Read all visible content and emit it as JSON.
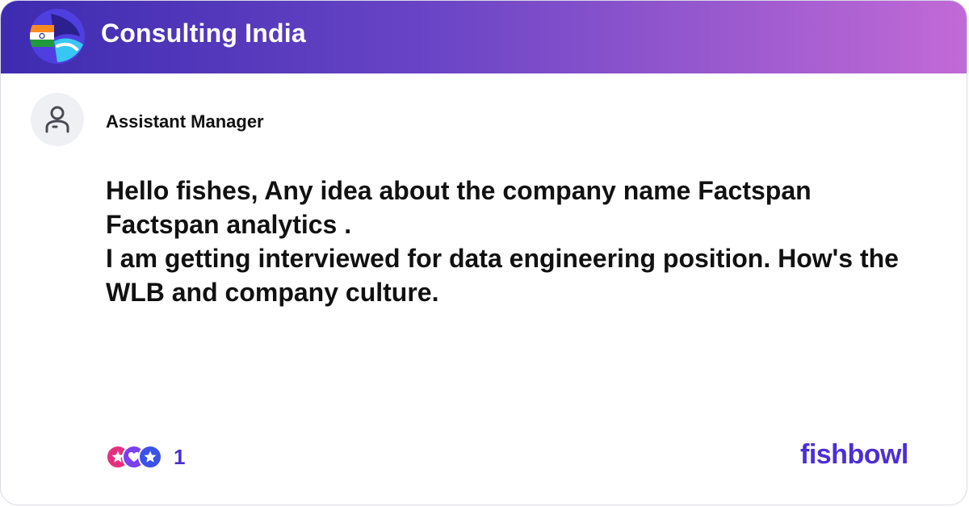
{
  "header": {
    "bowl_name": "Consulting India",
    "logo_icon": "india-flag-globe-icon"
  },
  "post": {
    "author_title": "Assistant Manager",
    "avatar_icon": "user-icon",
    "lines": [
      "Hello fishes, Any idea about the company name Factspan",
      "Factspan analytics .",
      "I am getting interviewed for data engineering position. How's the",
      "WLB and company culture."
    ]
  },
  "footer": {
    "reaction_icons": [
      "star-reaction-icon",
      "heart-reaction-icon",
      "star-reaction-icon"
    ],
    "reaction_count": "1",
    "brand": "fishbowl"
  },
  "colors": {
    "header_start": "#3d2bb0",
    "header_end": "#c26ad6",
    "brand": "#4a2fd6",
    "count": "#4b2fcf"
  }
}
